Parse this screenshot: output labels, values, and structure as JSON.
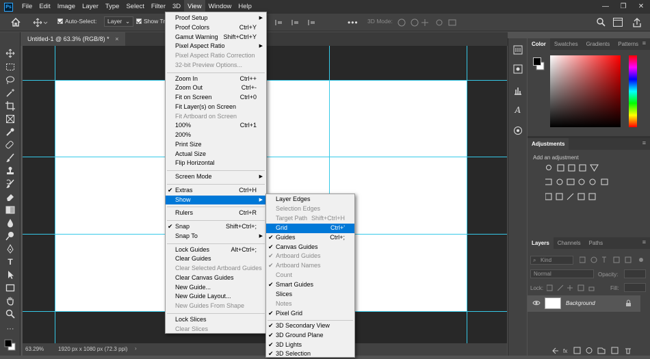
{
  "app": {
    "logo": "Ps"
  },
  "menubar": {
    "items": [
      "File",
      "Edit",
      "Image",
      "Layer",
      "Type",
      "Select",
      "Filter",
      "3D",
      "View",
      "Window",
      "Help"
    ],
    "active": "View",
    "window_controls": {
      "minimize": "—",
      "restore": "❐",
      "close": "✕"
    }
  },
  "options_bar": {
    "auto_select_label": "Auto-Select:",
    "layer_select_value": "Layer",
    "show_transform_label": "Show Tra",
    "mode_3d_label": "3D Mode:"
  },
  "document": {
    "tab_title": "Untitled-1 @ 63.3% (RGB/8) *",
    "tab_close": "×",
    "zoom": "63.29%",
    "doc_info": "1920 px x 1080 px (72.3 ppi)"
  },
  "view_menu": {
    "items": [
      {
        "label": "Proof Setup",
        "submenu": true
      },
      {
        "label": "Proof Colors",
        "shortcut": "Ctrl+Y"
      },
      {
        "label": "Gamut Warning",
        "shortcut": "Shift+Ctrl+Y"
      },
      {
        "label": "Pixel Aspect Ratio",
        "submenu": true
      },
      {
        "label": "Pixel Aspect Ratio Correction",
        "disabled": true
      },
      {
        "label": "32-bit Preview Options...",
        "disabled": true
      },
      {
        "sep": true
      },
      {
        "label": "Zoom In",
        "shortcut": "Ctrl++"
      },
      {
        "label": "Zoom Out",
        "shortcut": "Ctrl+-"
      },
      {
        "label": "Fit on Screen",
        "shortcut": "Ctrl+0"
      },
      {
        "label": "Fit Layer(s) on Screen"
      },
      {
        "label": "Fit Artboard on Screen",
        "disabled": true
      },
      {
        "label": "100%",
        "shortcut": "Ctrl+1"
      },
      {
        "label": "200%"
      },
      {
        "label": "Print Size"
      },
      {
        "label": "Actual Size"
      },
      {
        "label": "Flip Horizontal"
      },
      {
        "sep": true
      },
      {
        "label": "Screen Mode",
        "submenu": true
      },
      {
        "sep": true
      },
      {
        "label": "Extras",
        "shortcut": "Ctrl+H",
        "checked": true
      },
      {
        "label": "Show",
        "submenu": true,
        "highlighted": true
      },
      {
        "sep": true
      },
      {
        "label": "Rulers",
        "shortcut": "Ctrl+R"
      },
      {
        "sep": true
      },
      {
        "label": "Snap",
        "shortcut": "Shift+Ctrl+;",
        "checked": true
      },
      {
        "label": "Snap To",
        "submenu": true
      },
      {
        "sep": true
      },
      {
        "label": "Lock Guides",
        "shortcut": "Alt+Ctrl+;"
      },
      {
        "label": "Clear Guides"
      },
      {
        "label": "Clear Selected Artboard Guides",
        "disabled": true
      },
      {
        "label": "Clear Canvas Guides"
      },
      {
        "label": "New Guide..."
      },
      {
        "label": "New Guide Layout..."
      },
      {
        "label": "New Guides From Shape",
        "disabled": true
      },
      {
        "sep": true
      },
      {
        "label": "Lock Slices"
      },
      {
        "label": "Clear Slices",
        "disabled": true
      }
    ]
  },
  "show_submenu": {
    "items": [
      {
        "label": "Layer Edges"
      },
      {
        "label": "Selection Edges",
        "disabled": true
      },
      {
        "label": "Target Path",
        "shortcut": "Shift+Ctrl+H",
        "disabled": true
      },
      {
        "label": "Grid",
        "shortcut": "Ctrl+'",
        "highlighted": true
      },
      {
        "label": "Guides",
        "shortcut": "Ctrl+;",
        "checked": true
      },
      {
        "label": "Canvas Guides",
        "checked": true
      },
      {
        "label": "Artboard Guides",
        "checked": true,
        "disabled": true
      },
      {
        "label": "Artboard Names",
        "checked": true,
        "disabled": true
      },
      {
        "label": "Count",
        "disabled": true
      },
      {
        "label": "Smart Guides",
        "checked": true
      },
      {
        "label": "Slices"
      },
      {
        "label": "Notes",
        "disabled": true
      },
      {
        "label": "Pixel Grid",
        "checked": true
      },
      {
        "sep": true
      },
      {
        "label": "3D Secondary View",
        "checked": true
      },
      {
        "label": "3D Ground Plane",
        "checked": true
      },
      {
        "label": "3D Lights",
        "checked": true
      },
      {
        "label": "3D Selection",
        "checked": true
      }
    ]
  },
  "color_panel": {
    "tabs": [
      "Color",
      "Swatches",
      "Gradients",
      "Patterns"
    ],
    "active_tab": "Color",
    "hue_color": "#ff0000"
  },
  "adjustments_panel": {
    "title": "Adjustments",
    "subtitle": "Add an adjustment"
  },
  "layers_panel": {
    "tabs": [
      "Layers",
      "Channels",
      "Paths"
    ],
    "active_tab": "Layers",
    "filter_kind": "Kind",
    "blend_mode": "Normal",
    "opacity_label": "Opacity:",
    "lock_label": "Lock:",
    "fill_label": "Fill:",
    "layer_name": "Background"
  },
  "colors": {
    "guide": "#36c9e8",
    "highlight": "#0078d7"
  }
}
